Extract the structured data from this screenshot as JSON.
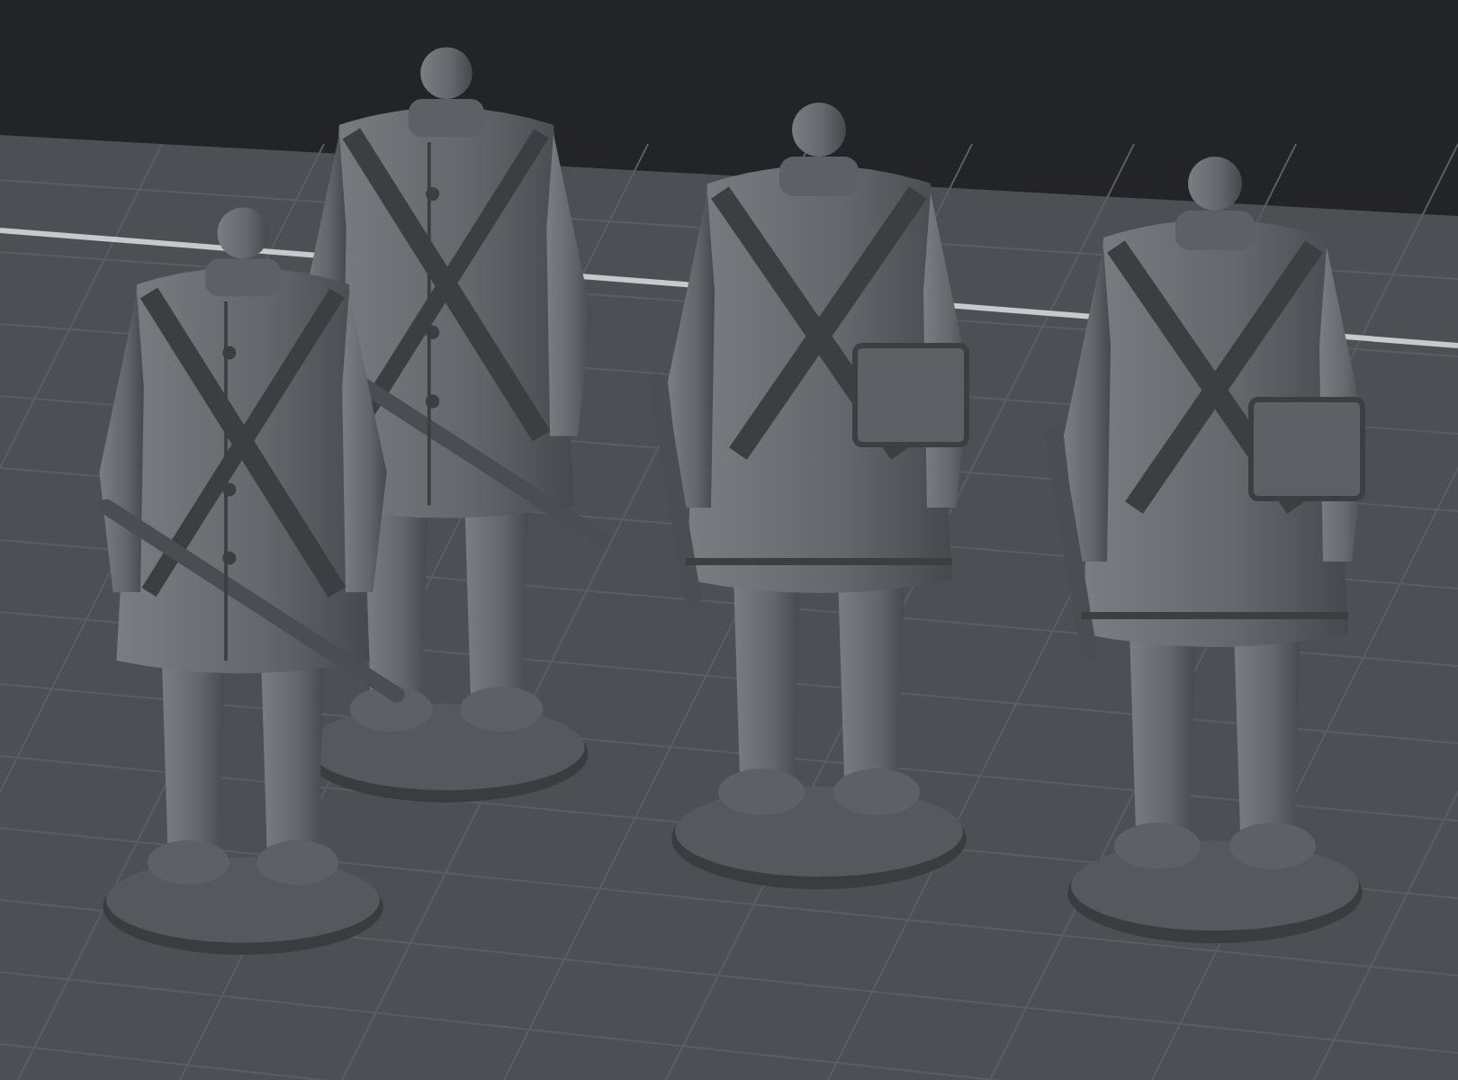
{
  "viewport": {
    "figures": [
      {
        "kind": "front"
      },
      {
        "kind": "front"
      },
      {
        "kind": "back"
      },
      {
        "kind": "back"
      }
    ]
  }
}
